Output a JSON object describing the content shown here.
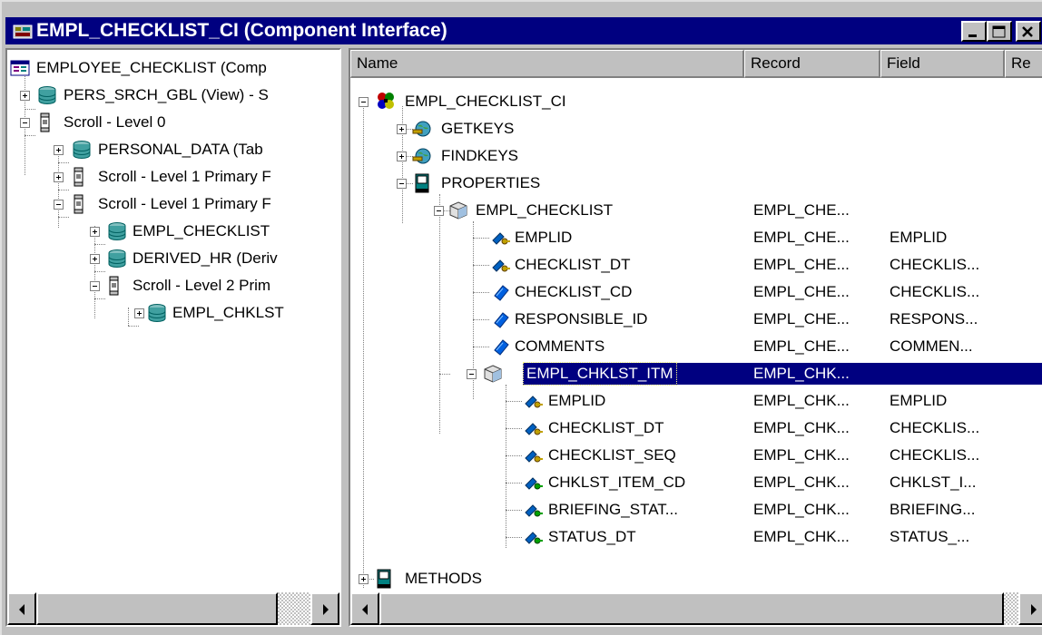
{
  "window": {
    "title": "EMPL_CHECKLIST_CI (Component Interface)",
    "accent": "#000080"
  },
  "left_tree": [
    {
      "label": "EMPLOYEE_CHECKLIST (Comp",
      "icon": "component-icon"
    },
    {
      "label": "PERS_SRCH_GBL (View) - S",
      "icon": "database-icon"
    },
    {
      "label": "Scroll - Level 0",
      "icon": "scroll-icon"
    },
    {
      "label": "PERSONAL_DATA (Tab",
      "icon": "database-icon"
    },
    {
      "label": "Scroll - Level 1  Primary F",
      "icon": "scroll-icon"
    },
    {
      "label": "Scroll - Level 1  Primary F",
      "icon": "scroll-icon"
    },
    {
      "label": "EMPL_CHECKLIST",
      "icon": "database-icon"
    },
    {
      "label": "DERIVED_HR (Deriv",
      "icon": "database-icon"
    },
    {
      "label": "Scroll - Level 2  Prim",
      "icon": "scroll-icon"
    },
    {
      "label": "EMPL_CHKLST",
      "icon": "database-icon"
    }
  ],
  "columns": [
    "Name",
    "Record",
    "Field",
    "Re"
  ],
  "right_tree": [
    {
      "name": "EMPL_CHECKLIST_CI",
      "record": "",
      "field": "",
      "icon": "component-interface-icon"
    },
    {
      "name": "GETKEYS",
      "record": "",
      "field": "",
      "icon": "keys-globe-icon"
    },
    {
      "name": "FINDKEYS",
      "record": "",
      "field": "",
      "icon": "keys-globe-icon"
    },
    {
      "name": "PROPERTIES",
      "record": "",
      "field": "",
      "icon": "book-icon"
    },
    {
      "name": "EMPL_CHECKLIST",
      "record": "EMPL_CHE...",
      "field": "",
      "icon": "collection-cube-icon"
    },
    {
      "name": "EMPLID",
      "record": "EMPL_CHE...",
      "field": "EMPLID",
      "icon": "key-property-icon"
    },
    {
      "name": "CHECKLIST_DT",
      "record": "EMPL_CHE...",
      "field": "CHECKLIS...",
      "icon": "key-property-icon"
    },
    {
      "name": "CHECKLIST_CD",
      "record": "EMPL_CHE...",
      "field": "CHECKLIS...",
      "icon": "property-icon"
    },
    {
      "name": "RESPONSIBLE_ID",
      "record": "EMPL_CHE...",
      "field": "RESPONS...",
      "icon": "property-icon"
    },
    {
      "name": "COMMENTS",
      "record": "EMPL_CHE...",
      "field": "COMMEN...",
      "icon": "property-icon"
    },
    {
      "name": "EMPL_CHKLST_ITM",
      "record": "EMPL_CHK...",
      "field": "",
      "icon": "collection-cube-icon"
    },
    {
      "name": "EMPLID",
      "record": "EMPL_CHK...",
      "field": "EMPLID",
      "icon": "key-property-icon"
    },
    {
      "name": "CHECKLIST_DT",
      "record": "EMPL_CHK...",
      "field": "CHECKLIS...",
      "icon": "key-property-icon"
    },
    {
      "name": "CHECKLIST_SEQ",
      "record": "EMPL_CHK...",
      "field": "CHECKLIS...",
      "icon": "key-property-icon"
    },
    {
      "name": "CHKLST_ITEM_CD",
      "record": "EMPL_CHK...",
      "field": "CHKLST_I...",
      "icon": "green-key-property-icon"
    },
    {
      "name": "BRIEFING_STAT...",
      "record": "EMPL_CHK...",
      "field": "BRIEFING...",
      "icon": "green-key-property-icon"
    },
    {
      "name": "STATUS_DT",
      "record": "EMPL_CHK...",
      "field": "STATUS_...",
      "icon": "green-key-property-icon"
    },
    {
      "name": "METHODS",
      "record": "",
      "field": "",
      "icon": "book-icon"
    }
  ]
}
